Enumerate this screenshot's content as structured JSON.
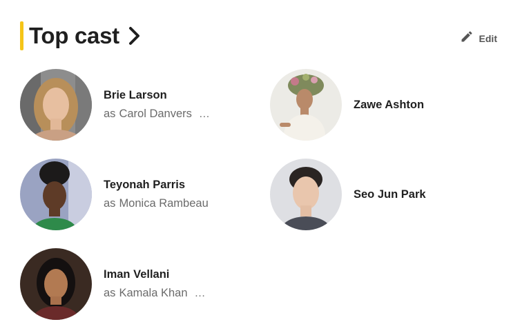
{
  "header": {
    "title": "Top cast",
    "edit_label": "Edit"
  },
  "cast": [
    {
      "name": "Brie Larson",
      "as_text": "as",
      "character": "Carol Danvers",
      "more": "…"
    },
    {
      "name": "Zawe Ashton"
    },
    {
      "name": "Teyonah Parris",
      "as_text": "as",
      "character": "Monica Rambeau"
    },
    {
      "name": "Seo Jun Park"
    },
    {
      "name": "Iman Vellani",
      "as_text": "as",
      "character": "Kamala Khan",
      "more": "…"
    }
  ],
  "colors": {
    "accent": "#f5c518",
    "title": "#1f1f1f",
    "secondary_text": "#6b6b6b"
  }
}
